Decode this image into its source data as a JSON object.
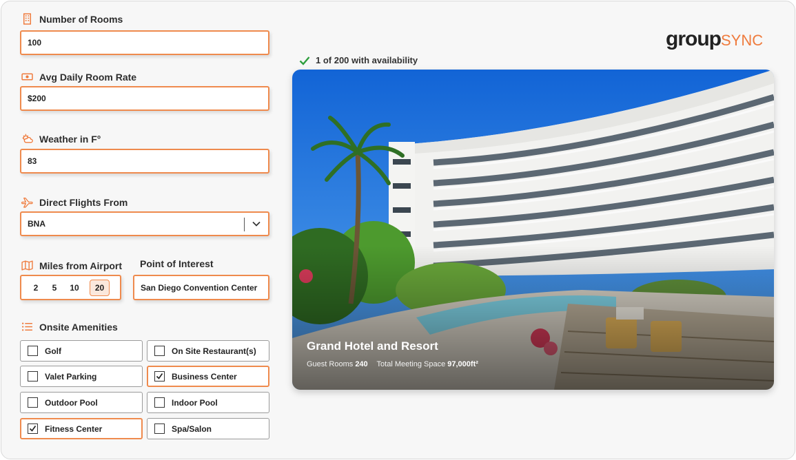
{
  "brand": {
    "logo_main": "group",
    "logo_accent": "SYNC"
  },
  "form": {
    "rooms": {
      "label": "Number of Rooms",
      "value": "100",
      "icon": "building-icon"
    },
    "rate": {
      "label": "Avg Daily Room Rate",
      "value": "$200",
      "icon": "money-icon"
    },
    "weather": {
      "label": "Weather in F°",
      "value": "83",
      "icon": "weather-icon"
    },
    "flights": {
      "label": "Direct Flights From",
      "value": "BNA",
      "icon": "plane-icon"
    },
    "miles": {
      "label": "Miles from Airport",
      "options": [
        "2",
        "5",
        "10",
        "20"
      ],
      "selected": "20",
      "icon": "map-icon"
    },
    "poi": {
      "label": "Point of Interest",
      "value": "San Diego Convention Center"
    },
    "amenities": {
      "label": "Onsite Amenities",
      "icon": "list-icon",
      "items": [
        {
          "label": "Golf",
          "checked": false
        },
        {
          "label": "On Site Restaurant(s)",
          "checked": false
        },
        {
          "label": "Valet Parking",
          "checked": false
        },
        {
          "label": "Business Center",
          "checked": true
        },
        {
          "label": "Outdoor Pool",
          "checked": false
        },
        {
          "label": "Indoor Pool",
          "checked": false
        },
        {
          "label": "Fitness Center",
          "checked": true
        },
        {
          "label": "Spa/Salon",
          "checked": false
        }
      ]
    }
  },
  "results": {
    "availability": "1 of 200 with availability",
    "hotel": {
      "name": "Grand Hotel and Resort",
      "rooms_label": "Guest Rooms",
      "rooms_value": "240",
      "space_label": "Total Meeting Space",
      "space_value": "97,000ft²"
    }
  },
  "colors": {
    "accent": "#ef8a4d",
    "check_green": "#2e9e3e"
  }
}
